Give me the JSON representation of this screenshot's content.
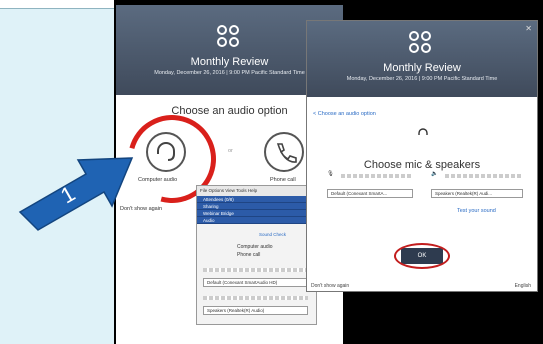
{
  "back_window": {
    "title": "Monthly Review",
    "subtitle": "Monday, December 26, 2016 | 9:00 PM Pacific Standard Time",
    "heading": "Choose an audio option",
    "computer_audio_label": "Computer audio",
    "phone_call_label": "Phone call",
    "or_text": "or",
    "dont_show": "Don't show again"
  },
  "panel": {
    "toolbar": "File  Options  View  Tools  Help",
    "rows": [
      "Attendees (0/8)",
      "Sharing",
      "Webinar Bridge",
      "Audio"
    ],
    "sound_check": "Sound Check",
    "options": [
      "Computer audio",
      "Phone call"
    ],
    "mic_select": "Default (Conexant SmartAudio HD)",
    "speaker_select": "Speakers (Realtek(R) Audio)"
  },
  "front_window": {
    "title": "Monthly Review",
    "subtitle": "Monday, December 26, 2016 | 9:00 PM Pacific Standard Time",
    "back_link": "< Choose an audio option",
    "heading": "Choose mic & speakers",
    "mic_select": "Default (Conexant SmartA...",
    "speaker_select": "Speakers (Realtek(R) Audi...",
    "test_link": "Test your sound",
    "ok_label": "OK",
    "footer_left": "Don't show again",
    "footer_right": "English"
  },
  "callout": {
    "number": "1"
  },
  "colors": {
    "callout_blue": "#1f63b3",
    "highlight_red": "#d9201b",
    "banner": "#4a5668"
  }
}
